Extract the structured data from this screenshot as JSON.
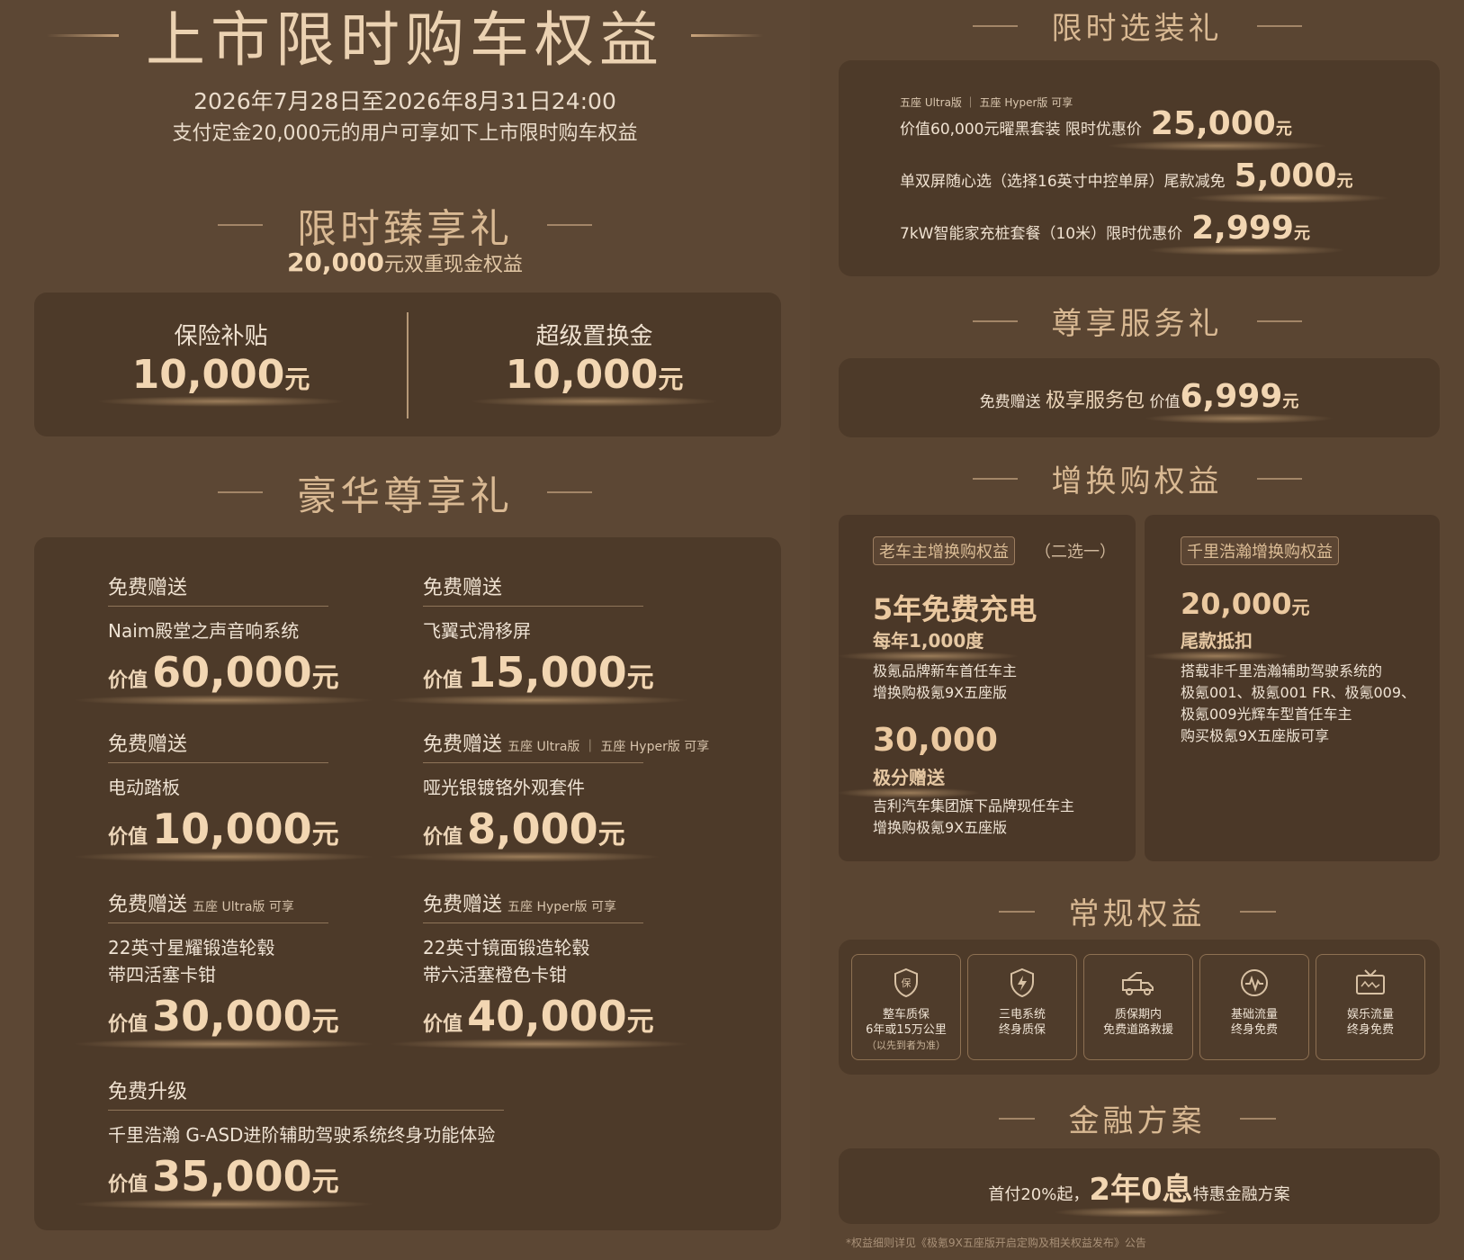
{
  "left": {
    "title": "上市限时购车权益",
    "date_range": "2026年7月28日至2026年8月31日24:00",
    "condition": "支付定金20,000元的用户可享如下上市限时购车权益",
    "exclusive": {
      "title": "限时臻享礼",
      "subtitle_num": "20,000",
      "subtitle_text": "元双重现金权益",
      "items": [
        {
          "label": "保险补贴",
          "value": "10,000",
          "unit": "元"
        },
        {
          "label": "超级置换金",
          "value": "10,000",
          "unit": "元"
        }
      ]
    },
    "luxury": {
      "title": "豪华尊享礼",
      "gifts": [
        {
          "head": "免费赠送",
          "tag": "",
          "name": "Naim殿堂之声音响系统",
          "pre": "价值",
          "value": "60,000",
          "unit": "元"
        },
        {
          "head": "免费赠送",
          "tag": "",
          "name": "飞翼式滑移屏",
          "pre": "价值",
          "value": "15,000",
          "unit": "元"
        },
        {
          "head": "免费赠送",
          "tag": "",
          "name": "电动踏板",
          "pre": "价值",
          "value": "10,000",
          "unit": "元"
        },
        {
          "head": "免费赠送",
          "tag": "五座 Ultra版 ｜ 五座 Hyper版  可享",
          "name": "哑光银镀铬外观套件",
          "pre": "价值",
          "value": "8,000",
          "unit": "元"
        },
        {
          "head": "免费赠送",
          "tag": "五座 Ultra版  可享",
          "name": "22英寸星耀锻造轮毂",
          "name2": "带四活塞卡钳",
          "pre": "价值",
          "value": "30,000",
          "unit": "元"
        },
        {
          "head": "免费赠送",
          "tag": "五座 Hyper版  可享",
          "name": "22英寸镜面锻造轮毂",
          "name2": "带六活塞橙色卡钳",
          "pre": "价值",
          "value": "40,000",
          "unit": "元"
        },
        {
          "head": "免费升级",
          "tag": "",
          "name": "千里浩瀚 G-ASD进阶辅助驾驶系统终身功能体验",
          "pre": "价值",
          "value": "35,000",
          "unit": "元"
        }
      ]
    }
  },
  "right": {
    "options": {
      "title": "限时选装礼",
      "items": [
        {
          "tag": "五座 Ultra版 ｜ 五座 Hyper版  可享",
          "text": "价值60,000元曜黑套装  限时优惠价",
          "value": "25,000",
          "unit": "元"
        },
        {
          "tag": "",
          "text": "单双屏随心选（选择16英寸中控单屏）尾款减免",
          "value": "5,000",
          "unit": "元"
        },
        {
          "tag": "",
          "text": "7kW智能家充桩套餐（10米）限时优惠价",
          "value": "2,999",
          "unit": "元"
        }
      ]
    },
    "service": {
      "title": "尊享服务礼",
      "prefix": "免费赠送",
      "name": "极享服务包",
      "pre": "价值",
      "value": "6,999",
      "unit": "元"
    },
    "tradein": {
      "title": "增换购权益",
      "left": {
        "badge": "老车主增换购权益",
        "option": "（二选一）",
        "big1": "5年免费充电",
        "sub1": "每年1,000度",
        "desc1a": "极氪品牌新车首任车主",
        "desc1b": "增换购极氪9X五座版",
        "big2": "30,000",
        "sub2": "极分赠送",
        "desc2a": "吉利汽车集团旗下品牌现任车主",
        "desc2b": "增换购极氪9X五座版"
      },
      "right": {
        "badge": "千里浩瀚增换购权益",
        "big": "20,000",
        "unit": "元",
        "sub": "尾款抵扣",
        "desc_a": "搭载非千里浩瀚辅助驾驶系统的",
        "desc_b": "极氪001、极氪001 FR、极氪009、",
        "desc_c": "极氪009光辉车型首任车主",
        "desc_d": "购买极氪9X五座版可享"
      }
    },
    "regular": {
      "title": "常规权益",
      "perks": [
        {
          "icon": "shield-bao-icon",
          "line1": "整车质保",
          "line2": "6年或15万公里",
          "line3": "（以先到者为准）"
        },
        {
          "icon": "shield-bolt-icon",
          "line1": "三电系统",
          "line2": "终身质保",
          "line3": ""
        },
        {
          "icon": "tow-truck-icon",
          "line1": "质保期内",
          "line2": "免费道路救援",
          "line3": ""
        },
        {
          "icon": "signal-pulse-icon",
          "line1": "基础流量",
          "line2": "终身免费",
          "line3": ""
        },
        {
          "icon": "tv-wave-icon",
          "line1": "娱乐流量",
          "line2": "终身免费",
          "line3": ""
        }
      ]
    },
    "finance": {
      "title": "金融方案",
      "pre": "首付20%起，",
      "highlight": "2年0息",
      "post": "特惠金融方案"
    },
    "footnote": "*权益细则详见《极氪9X五座版开启定购及相关权益发布》公告"
  },
  "colors": {
    "background": "#5c4734",
    "panel": "#4d3a29",
    "gold": "#f2d6b2",
    "title_gold": "#d9b993"
  }
}
